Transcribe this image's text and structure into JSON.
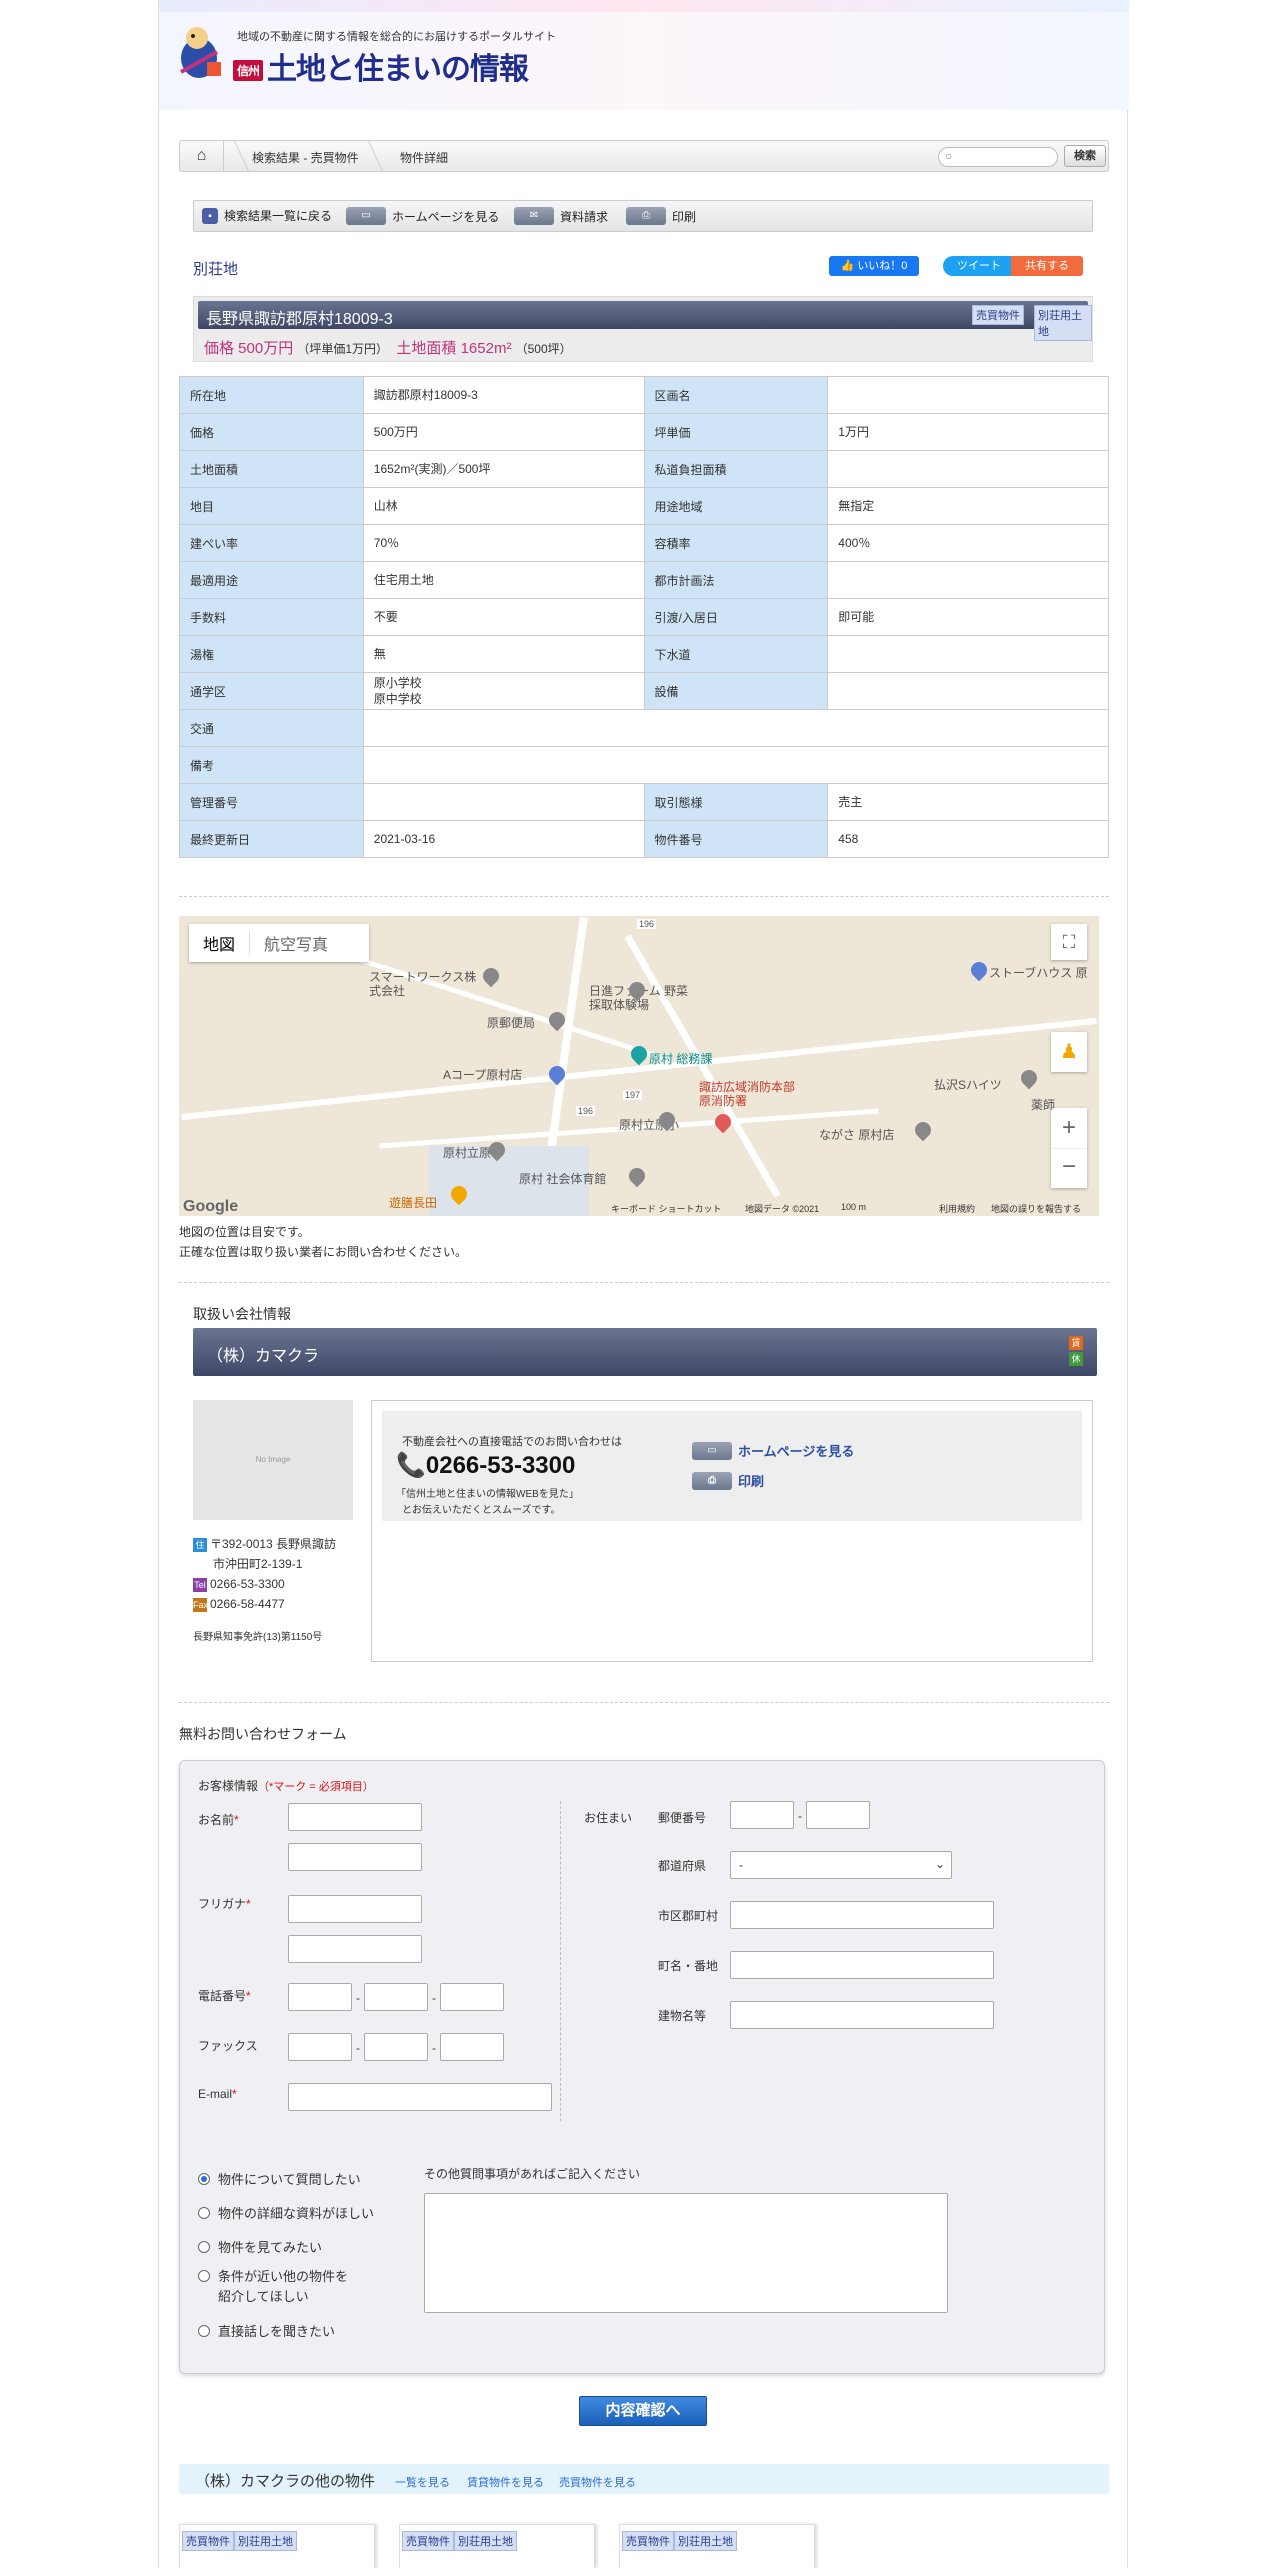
{
  "header": {
    "tagline": "地域の不動産に関する情報を総合的にお届けするポータルサイト",
    "logo_sub": "信州",
    "logo": "土地と住まいの情報"
  },
  "breadcrumb": [
    "検索結果 - 売買物件",
    "物件詳細"
  ],
  "search": {
    "button": "検索",
    "placeholder": ""
  },
  "toolbar": {
    "back": "検索結果一覧に戻る",
    "homepage": "ホームページを見る",
    "request": "資料請求",
    "print": "印刷"
  },
  "property": {
    "category": "別荘地",
    "like": "いいね！0",
    "tweet": "ツイート",
    "share": "共有する",
    "title": "長野県諏訪郡原村18009-3",
    "tags": [
      "売買物件",
      "別荘用土地"
    ],
    "price": "価格 500万円",
    "unit_price": "（坪単価1万円）",
    "area": "土地面積 1652m²",
    "area_tsubo": "（500坪）"
  },
  "details": [
    [
      [
        "所在地",
        "諏訪郡原村18009-3"
      ],
      [
        "区画名",
        ""
      ]
    ],
    [
      [
        "価格",
        "500万円"
      ],
      [
        "坪単価",
        "1万円"
      ]
    ],
    [
      [
        "土地面積",
        "1652m²(実測)／500坪"
      ],
      [
        "私道負担面積",
        ""
      ]
    ],
    [
      [
        "地目",
        "山林"
      ],
      [
        "用途地域",
        "無指定"
      ]
    ],
    [
      [
        "建ぺい率",
        "70％"
      ],
      [
        "容積率",
        "400％"
      ]
    ],
    [
      [
        "最適用途",
        "住宅用土地"
      ],
      [
        "都市計画法",
        ""
      ]
    ],
    [
      [
        "手数料",
        "不要"
      ],
      [
        "引渡/入居日",
        "即可能"
      ]
    ],
    [
      [
        "湯権",
        "無"
      ],
      [
        "下水道",
        ""
      ]
    ],
    [
      [
        "通学区",
        "原小学校\n原中学校"
      ],
      [
        "設備",
        ""
      ]
    ],
    [
      [
        "交通",
        ""
      ]
    ],
    [
      [
        "備考",
        ""
      ]
    ],
    [
      [
        "管理番号",
        ""
      ],
      [
        "取引態様",
        "売主"
      ]
    ],
    [
      [
        "最終更新日",
        "2021-03-16"
      ],
      [
        "物件番号",
        "458"
      ]
    ]
  ],
  "map": {
    "tab_map": "地図",
    "tab_aerial": "航空写真",
    "labels": [
      "スマートワークス株式会社",
      "日進ファーム 野菜採取体験場",
      "原郵便局",
      "原村 総務課",
      "Aコープ原村店",
      "諏訪広域消防本部 原消防署",
      "原村立原小",
      "原村立原中",
      "原村 社会体育館",
      "ながさ 原村店",
      "払沢Sハイツ",
      "ストーブハウス 原",
      "遊膳長田",
      "薬師"
    ],
    "route_numbers": [
      "196",
      "196",
      "197"
    ],
    "google": "Google",
    "footer": [
      "キーボード ショートカット",
      "地図データ ©2021",
      "100 m",
      "利用規約",
      "地図の誤りを報告する"
    ],
    "note1": "地図の位置は目安です。",
    "note2": "正確な位置は取り扱い業者にお問い合わせください。"
  },
  "company": {
    "section": "取扱い会社情報",
    "name": "（株）カマクラ",
    "badge_top": "賃",
    "badge_bottom": "休",
    "noimage": "No Image",
    "zip_addr": "〒392-0013 長野県諏訪",
    "addr2": "市沖田町2-139-1",
    "tel": "0266-53-3300",
    "fax": "0266-58-4477",
    "license": "長野県知事免許(13)第1150号",
    "tel_note": "不動産会社への直接電話でのお問い合わせは",
    "tel_big": "0266-53-3300",
    "tel_sub1": "「信州土地と住まいの情報WEBを見た」",
    "tel_sub2": "とお伝えいただくとスムーズです。",
    "link_home": "ホームページを見る",
    "link_print": "印刷"
  },
  "form": {
    "title": "無料お問い合わせフォーム",
    "customer": "お客様情報",
    "required_note": "（*マーク = 必須項目）",
    "name": "お名前",
    "kana": "フリガナ",
    "phone": "電話番号",
    "fax": "ファックス",
    "email": "E-mail",
    "address": "お住まい",
    "zip": "郵便番号",
    "pref": "都道府県",
    "pref_value": "-",
    "city": "市区郡町村",
    "town": "町名・番地",
    "building": "建物名等",
    "options": [
      "物件について質問したい",
      "物件の詳細な資料がほしい",
      "物件を見てみたい",
      "条件が近い他の物件を\n紹介してほしい",
      "直接話しを聞きたい"
    ],
    "other": "その他質問事項があればご記入ください",
    "submit": "内容確認へ"
  },
  "others": {
    "title": "（株）カマクラの他の物件",
    "links": [
      "一覧を見る",
      "賃貸物件を見る",
      "売買物件を見る"
    ],
    "card_tags": [
      "売買物件",
      "別荘用土地"
    ]
  },
  "colors": {
    "header_bar": "#4a5374",
    "label_bg": "#cfe5f7",
    "price": "#c2337a",
    "submit": "#2b6bd6"
  }
}
